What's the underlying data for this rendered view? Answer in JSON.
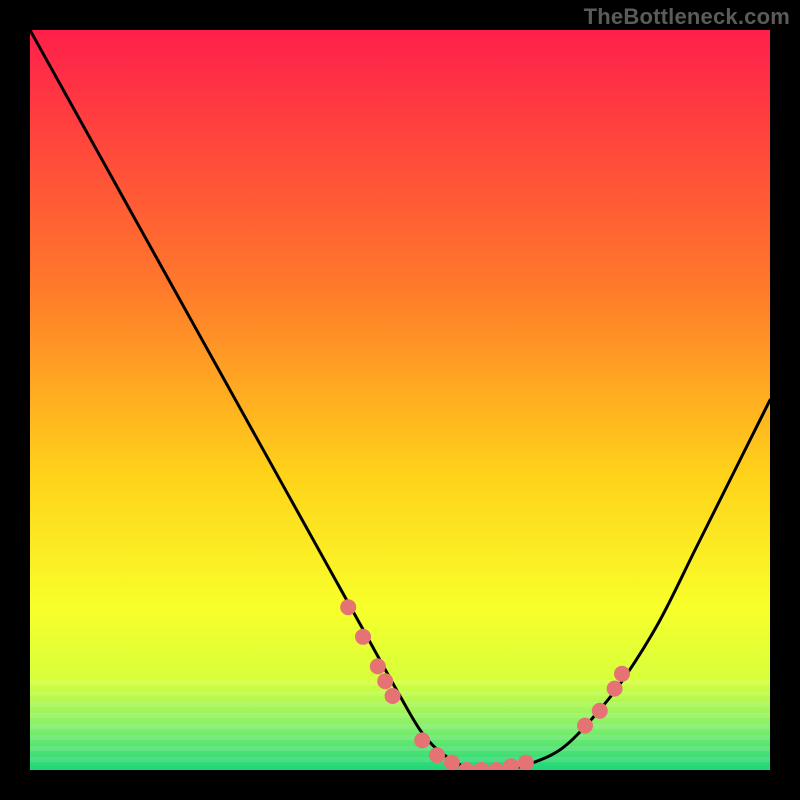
{
  "watermark": "TheBottleneck.com",
  "chart_data": {
    "type": "line",
    "title": "",
    "xlabel": "",
    "ylabel": "",
    "xlim": [
      0,
      100
    ],
    "ylim": [
      0,
      100
    ],
    "grid": false,
    "legend": false,
    "gradient_stops": [
      {
        "offset": 0.0,
        "color": "#ff1f4b"
      },
      {
        "offset": 0.35,
        "color": "#ff7a2a"
      },
      {
        "offset": 0.6,
        "color": "#ffd21a"
      },
      {
        "offset": 0.78,
        "color": "#f8ff2a"
      },
      {
        "offset": 0.88,
        "color": "#d6ff3c"
      },
      {
        "offset": 0.94,
        "color": "#86f06a"
      },
      {
        "offset": 1.0,
        "color": "#1fd67a"
      }
    ],
    "series": [
      {
        "name": "bottleneck-curve",
        "color": "#000000",
        "x": [
          0,
          5,
          10,
          15,
          20,
          25,
          30,
          35,
          40,
          45,
          50,
          53,
          56,
          60,
          64,
          68,
          72,
          76,
          80,
          85,
          90,
          95,
          100
        ],
        "y": [
          100,
          91,
          82,
          73,
          64,
          55,
          46,
          37,
          28,
          19,
          10,
          5,
          2,
          0,
          0,
          1,
          3,
          7,
          12,
          20,
          30,
          40,
          50
        ]
      }
    ],
    "markers": {
      "name": "highlight-dots",
      "color": "#e57373",
      "radius": 8,
      "points": [
        {
          "x": 43,
          "y": 22
        },
        {
          "x": 45,
          "y": 18
        },
        {
          "x": 47,
          "y": 14
        },
        {
          "x": 48,
          "y": 12
        },
        {
          "x": 49,
          "y": 10
        },
        {
          "x": 53,
          "y": 4
        },
        {
          "x": 55,
          "y": 2
        },
        {
          "x": 57,
          "y": 1
        },
        {
          "x": 59,
          "y": 0
        },
        {
          "x": 61,
          "y": 0
        },
        {
          "x": 63,
          "y": 0
        },
        {
          "x": 65,
          "y": 0.5
        },
        {
          "x": 67,
          "y": 1
        },
        {
          "x": 75,
          "y": 6
        },
        {
          "x": 77,
          "y": 8
        },
        {
          "x": 79,
          "y": 11
        },
        {
          "x": 80,
          "y": 13
        }
      ]
    }
  }
}
